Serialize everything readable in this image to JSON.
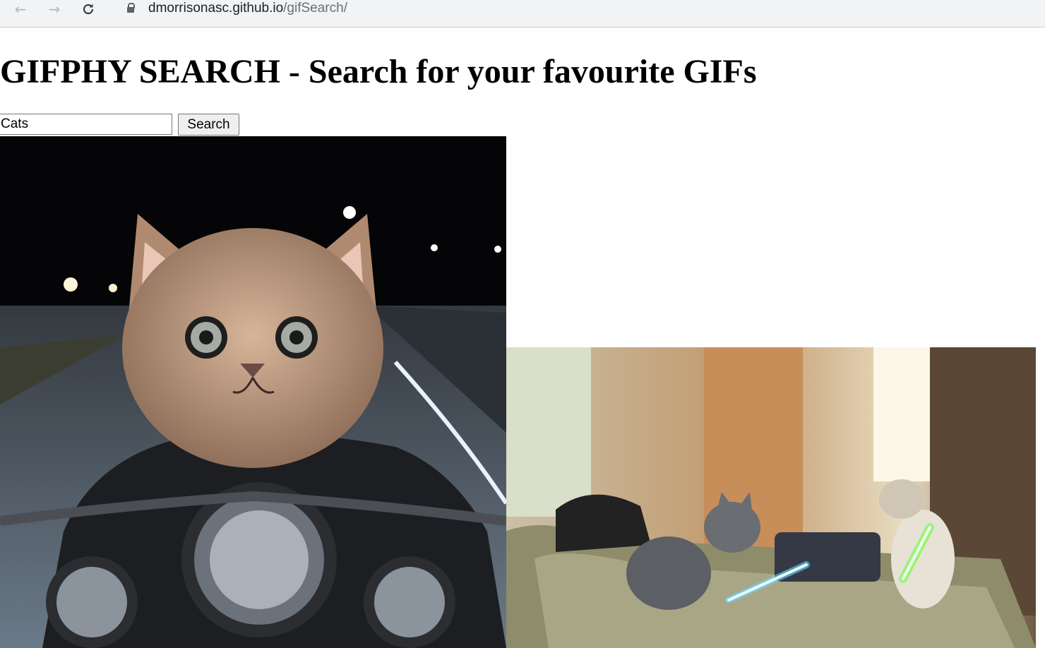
{
  "browser": {
    "url_host": "dmorrisonasc.github.io",
    "url_path": "/gifSearch/",
    "back_icon": "arrow-left-icon",
    "forward_icon": "arrow-right-icon",
    "reload_icon": "reload-icon",
    "lock_icon": "lock-icon"
  },
  "page": {
    "title": "GIFPHY SEARCH - Search for your favourite GIFs",
    "search": {
      "value": "Cats",
      "button_label": "Search"
    },
    "results": [
      {
        "alt": "kitten riding motorcycle at night"
      },
      {
        "alt": "cats fighting with lightsabers on couch"
      }
    ]
  }
}
